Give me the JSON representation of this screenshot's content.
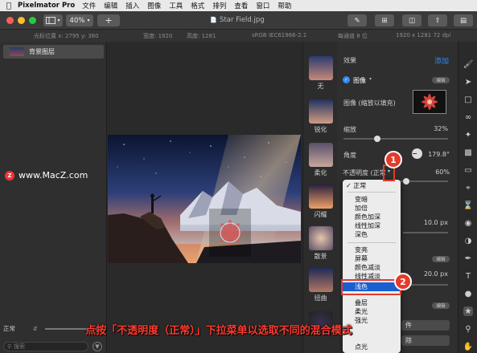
{
  "menubar": {
    "apple_icon": "apple-icon",
    "app_name": "Pixelmator Pro",
    "items": [
      "文件",
      "编辑",
      "插入",
      "图像",
      "工具",
      "格式",
      "排列",
      "查看",
      "窗口",
      "帮助"
    ]
  },
  "titlebar": {
    "zoom": "40%",
    "add": "+",
    "document_title": "Star Field.jpg",
    "traffic_colors": [
      "#fc5f57",
      "#fdbc2e",
      "#28c840"
    ]
  },
  "infobar": {
    "cursor_label": "光标位置 x: 2795  y: 380",
    "width": "宽度: 1920",
    "height": "高度: 1281",
    "color_profile": "sRGB IEC61966-2.1",
    "bit_depth": "每通道 8 位",
    "dimensions": "1920 x 1281 72 dpi"
  },
  "layers": {
    "items": [
      {
        "name": "背景图层"
      }
    ],
    "blend_mode": "正常",
    "search_placeholder": "搜索"
  },
  "watermark": {
    "text": "www.MacZ.com",
    "logo": "Z"
  },
  "presets": [
    {
      "label": "无"
    },
    {
      "label": "锐化"
    },
    {
      "label": "柔化"
    },
    {
      "label": "闪耀"
    },
    {
      "label": "散景"
    },
    {
      "label": "扭曲"
    }
  ],
  "effects_panel": {
    "title": "效果",
    "add_label": "添加",
    "image_effect_label": "图像",
    "edit_pill": "编辑",
    "image_fill_label": "图像 (缩放以填充)",
    "scale_label": "缩放",
    "scale_value": "32%",
    "scale_level": 0.32,
    "angle_label": "角度",
    "angle_value": "179.8°",
    "opacity_label": "不透明度 (正常",
    "opacity_value": "60%",
    "opacity_level": 0.6,
    "value_1": "10.0 px",
    "value_2": "20.0 px",
    "edit_pill_2": "编辑",
    "edit_pill_3": "编辑",
    "partial_1": "件",
    "partial_2": "除"
  },
  "blend_menu": {
    "groups": [
      [
        "正常"
      ],
      [
        "变暗",
        "加倍",
        "颜色加深",
        "线性加深",
        "深色"
      ],
      [
        "变亮",
        "屏幕",
        "颜色减淡",
        "线性减淡",
        "浅色"
      ],
      [
        "叠层",
        "柔光",
        "强光",
        "点光"
      ]
    ],
    "checked": "正常",
    "highlighted": "浅色",
    "highlight_color": "#1a5fd0"
  },
  "annotations": {
    "badge_1": "1",
    "badge_2": "2",
    "caption": "点按「不透明度（正常）」下拉菜单以选取不同的混合模式",
    "color": "#e53a2a"
  },
  "tools": [
    "paint-brush-icon",
    "arrow-icon",
    "marquee-icon",
    "lasso-icon",
    "magic-wand-icon",
    "gradient-icon",
    "eraser-icon",
    "clone-icon",
    "color-picker-icon",
    "retouch-icon",
    "paint-bucket-icon",
    "pen-icon",
    "text-icon",
    "shape-icon",
    "effects-icon",
    "zoom-icon",
    "hand-icon"
  ]
}
